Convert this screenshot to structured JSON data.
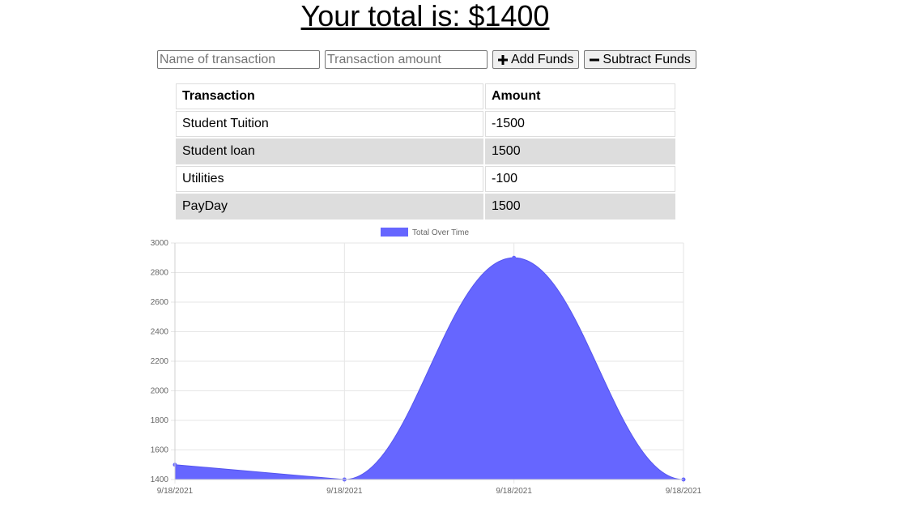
{
  "header": {
    "total_text": "Your total is: $1400"
  },
  "form": {
    "name_placeholder": "Name of transaction",
    "amount_placeholder": "Transaction amount",
    "add_label": "Add Funds",
    "subtract_label": "Subtract Funds"
  },
  "table": {
    "headers": [
      "Transaction",
      "Amount"
    ],
    "rows": [
      {
        "name": "Student Tuition",
        "amount": "-1500"
      },
      {
        "name": "Student loan",
        "amount": "1500"
      },
      {
        "name": "Utilities",
        "amount": "-100"
      },
      {
        "name": "PayDay",
        "amount": "1500"
      }
    ]
  },
  "chart_data": {
    "type": "area",
    "title": "",
    "xlabel": "",
    "ylabel": "",
    "x": [
      "9/18/2021",
      "9/18/2021",
      "9/18/2021",
      "9/18/2021"
    ],
    "series": [
      {
        "name": "Total Over Time",
        "values": [
          1500,
          1400,
          2900,
          1400
        ],
        "color": "#6666ff"
      }
    ],
    "ylim": [
      1400,
      3000
    ],
    "yticks": [
      1400,
      1600,
      1800,
      2000,
      2200,
      2400,
      2600,
      2800,
      3000
    ],
    "grid": true,
    "legend": "top-center"
  }
}
